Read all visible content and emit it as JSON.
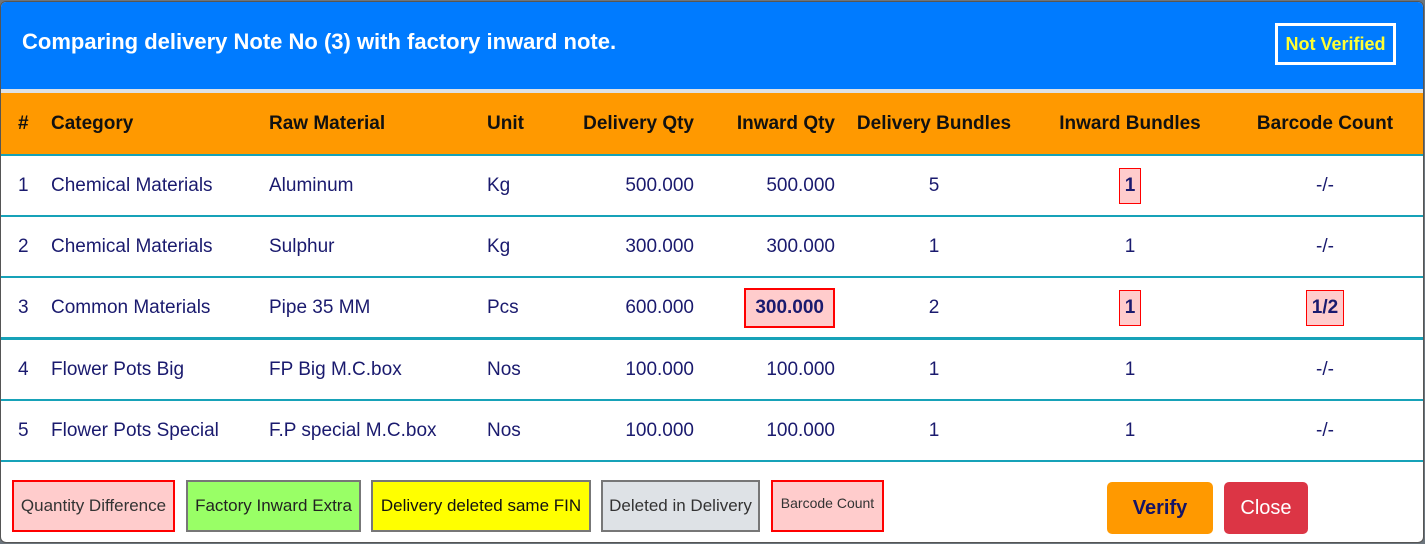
{
  "header": {
    "title": "Comparing delivery Note No (3) with factory inward note.",
    "status_badge": "Not Verified"
  },
  "table": {
    "columns": [
      "#",
      "Category",
      "Raw Material",
      "Unit",
      "Delivery Qty",
      "Inward Qty",
      "Delivery Bundles",
      "Inward Bundles",
      "Barcode Count"
    ],
    "rows": [
      {
        "num": "1",
        "category": "Chemical Materials",
        "raw_material": "Aluminum",
        "unit": "Kg",
        "delivery_qty": "500.000",
        "inward_qty": "500.000",
        "delivery_bundles": "5",
        "inward_bundles": "1",
        "barcode_count": "-/-",
        "flags": {
          "inward_qty": false,
          "inward_bundles": true,
          "barcode_count": false
        }
      },
      {
        "num": "2",
        "category": "Chemical Materials",
        "raw_material": "Sulphur",
        "unit": "Kg",
        "delivery_qty": "300.000",
        "inward_qty": "300.000",
        "delivery_bundles": "1",
        "inward_bundles": "1",
        "barcode_count": "-/-",
        "flags": {
          "inward_qty": false,
          "inward_bundles": false,
          "barcode_count": false
        }
      },
      {
        "num": "3",
        "category": "Common Materials",
        "raw_material": "Pipe 35 MM",
        "unit": "Pcs",
        "delivery_qty": "600.000",
        "inward_qty": "300.000",
        "delivery_bundles": "2",
        "inward_bundles": "1",
        "barcode_count": "1/2",
        "flags": {
          "inward_qty": true,
          "inward_bundles": true,
          "barcode_count": true
        }
      },
      {
        "num": "4",
        "category": "Flower Pots Big",
        "raw_material": "FP Big M.C.box",
        "unit": "Nos",
        "delivery_qty": "100.000",
        "inward_qty": "100.000",
        "delivery_bundles": "1",
        "inward_bundles": "1",
        "barcode_count": "-/-",
        "flags": {
          "inward_qty": false,
          "inward_bundles": false,
          "barcode_count": false
        }
      },
      {
        "num": "5",
        "category": "Flower Pots Special",
        "raw_material": "F.P special M.C.box",
        "unit": "Nos",
        "delivery_qty": "100.000",
        "inward_qty": "100.000",
        "delivery_bundles": "1",
        "inward_bundles": "1",
        "barcode_count": "-/-",
        "flags": {
          "inward_qty": false,
          "inward_bundles": false,
          "barcode_count": false
        }
      }
    ]
  },
  "legend": {
    "quantity_difference": "Quantity Difference",
    "factory_inward_extra": "Factory Inward Extra",
    "delivery_deleted_same_fin": "Delivery deleted same FIN",
    "deleted_in_delivery": "Deleted in Delivery",
    "barcode_count": "Barcode Count"
  },
  "buttons": {
    "verify": "Verify",
    "close": "Close"
  },
  "colors": {
    "header": "#007bff",
    "table_header": "#ff9900",
    "status_text": "#ffff33",
    "diff_bg": "#ffcccc",
    "diff_border": "#ff0000",
    "extra_bg": "#99ff66",
    "deleted_fin_bg": "#ffff00",
    "deleted_bg": "#dee2e6",
    "verify_bg": "#ff9900",
    "close_bg": "#dc3545",
    "row_divider": "#17a2b8"
  }
}
